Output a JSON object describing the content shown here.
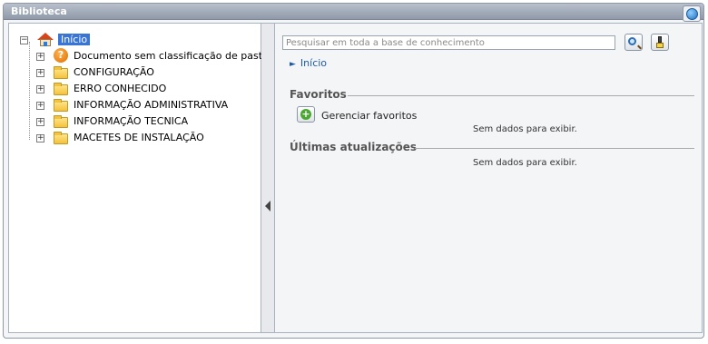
{
  "window": {
    "title": "Biblioteca"
  },
  "tree": {
    "root": "Início",
    "children": [
      "Documento sem classificação de pasta",
      "CONFIGURAÇÃO",
      "ERRO CONHECIDO",
      "INFORMAÇÃO ADMINISTRATIVA",
      "INFORMAÇÃO TECNICA",
      "MACETES DE INSTALAÇÃO"
    ]
  },
  "search": {
    "placeholder": "Pesquisar em toda a base de conhecimento"
  },
  "breadcrumb": {
    "label": "Início"
  },
  "favorites": {
    "title": "Favoritos",
    "manage_label": "Gerenciar favoritos",
    "empty": "Sem dados para exibir."
  },
  "updates": {
    "title": "Últimas atualizações",
    "empty": "Sem dados para exibir."
  },
  "icons": {
    "help": "help-globe-icon",
    "search": "magnifier-icon",
    "clear": "brush-icon",
    "root": "home-icon",
    "unclassified": "question-icon",
    "folder": "folder-icon",
    "collapse": "splitter-arrow-icon"
  }
}
